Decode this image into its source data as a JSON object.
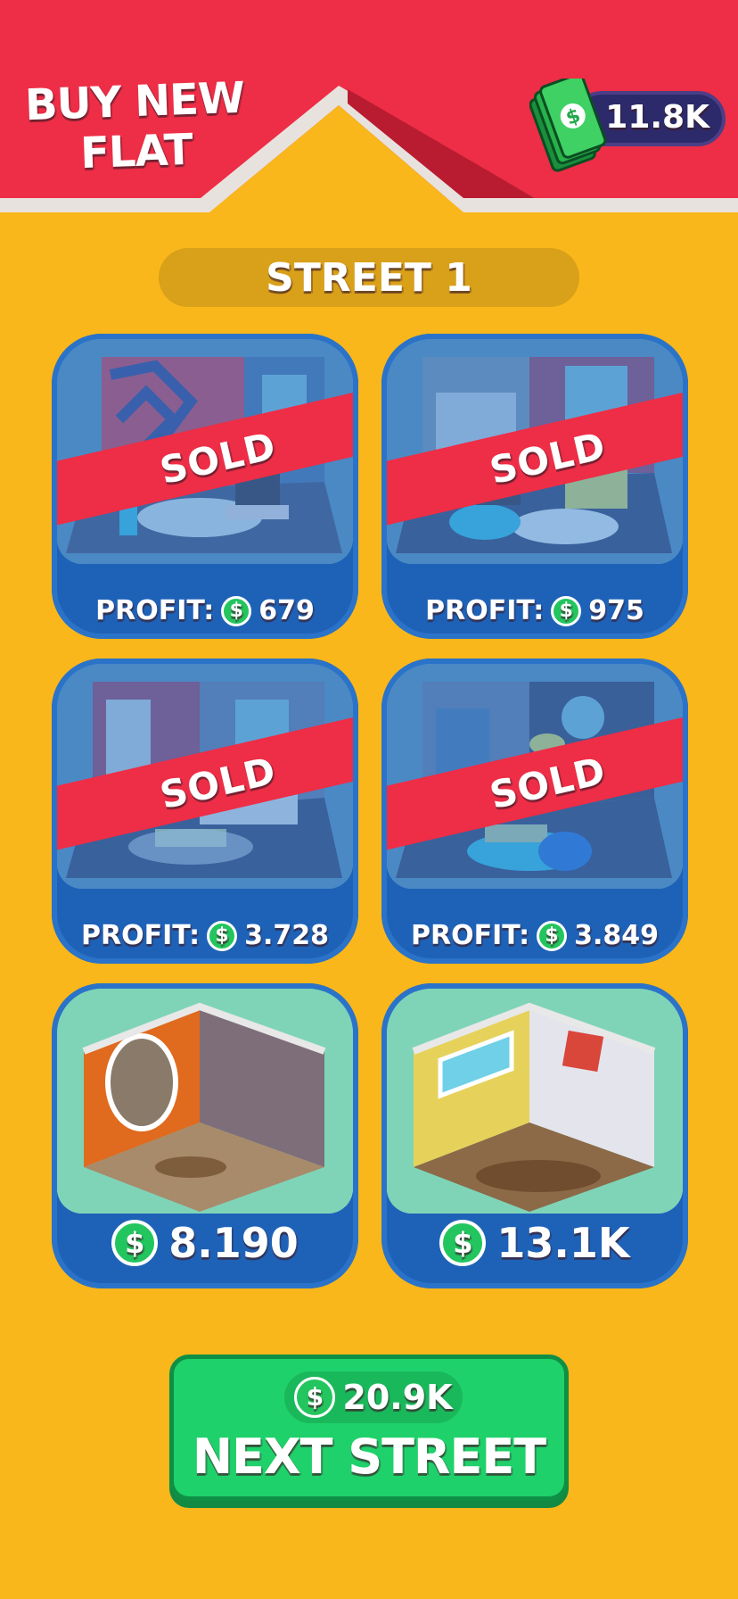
{
  "header": {
    "title_line1": "BUY NEW",
    "title_line2": "FLAT",
    "cash": "11.8K",
    "colors": {
      "banner": "#EE2D46",
      "roof": "#E8E2DE",
      "background": "#F9B71C"
    }
  },
  "street": {
    "label": "STREET 1"
  },
  "flats": [
    {
      "status": "SOLD",
      "profit_label": "PROFIT:",
      "profit": "679"
    },
    {
      "status": "SOLD",
      "profit_label": "PROFIT:",
      "profit": "975"
    },
    {
      "status": "SOLD",
      "profit_label": "PROFIT:",
      "profit": "3.728"
    },
    {
      "status": "SOLD",
      "profit_label": "PROFIT:",
      "profit": "3.849"
    },
    {
      "price": "8.190"
    },
    {
      "price": "13.1K"
    }
  ],
  "icons": {
    "currency": "$",
    "cash_icon": "money-stack-icon",
    "coin_icon": "dollar-coin-icon"
  },
  "next_street": {
    "cost": "20.9K",
    "label": "NEXT STREET"
  }
}
